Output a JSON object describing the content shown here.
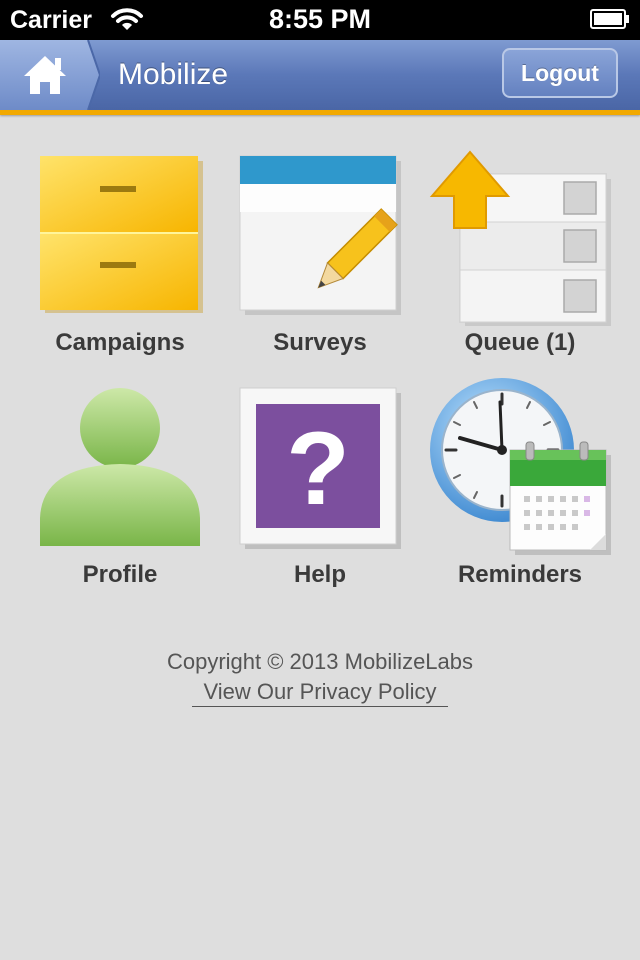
{
  "status_bar": {
    "carrier": "Carrier",
    "time": "8:55 PM",
    "wifi_icon": "wifi-icon",
    "battery_icon": "battery-icon"
  },
  "nav_bar": {
    "title": "Mobilize",
    "home_icon": "home-icon",
    "logout_label": "Logout",
    "accent_color": "#f2a900",
    "bar_color": "#5b78b8"
  },
  "tiles": [
    {
      "label": "Campaigns",
      "icon": "file-cabinet-icon"
    },
    {
      "label": "Surveys",
      "icon": "survey-pencil-icon"
    },
    {
      "label": "Queue (1)",
      "icon": "upload-queue-icon"
    },
    {
      "label": "Profile",
      "icon": "person-icon"
    },
    {
      "label": "Help",
      "icon": "question-mark-icon"
    },
    {
      "label": "Reminders",
      "icon": "clock-calendar-icon"
    }
  ],
  "footer": {
    "copyright": "Copyright © 2013 MobilizeLabs",
    "privacy_link": "View Our Privacy Policy"
  }
}
